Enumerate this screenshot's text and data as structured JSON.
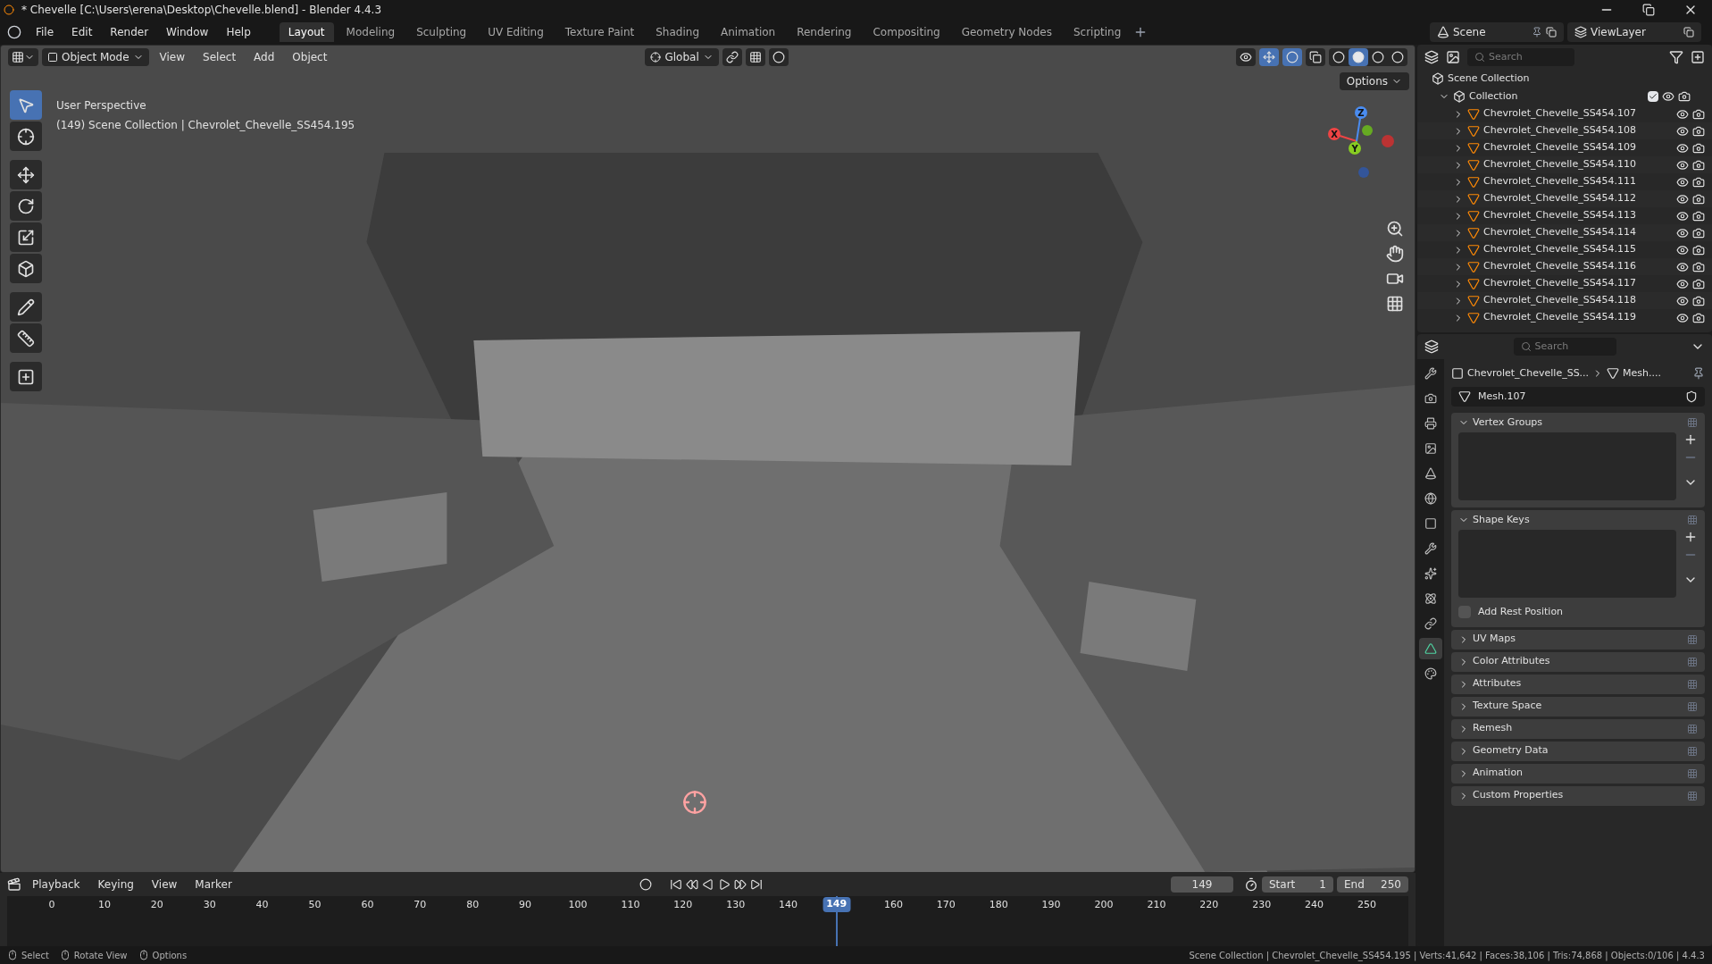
{
  "title_bar": {
    "title": "* Chevelle [C:\\Users\\erena\\Desktop\\Chevelle.blend] - Blender 4.4.3"
  },
  "menu": [
    "File",
    "Edit",
    "Render",
    "Window",
    "Help"
  ],
  "workspaces": [
    {
      "label": "Layout",
      "selected": true
    },
    {
      "label": "Modeling",
      "selected": false
    },
    {
      "label": "Sculpting",
      "selected": false
    },
    {
      "label": "UV Editing",
      "selected": false
    },
    {
      "label": "Texture Paint",
      "selected": false
    },
    {
      "label": "Shading",
      "selected": false
    },
    {
      "label": "Animation",
      "selected": false
    },
    {
      "label": "Rendering",
      "selected": false
    },
    {
      "label": "Compositing",
      "selected": false
    },
    {
      "label": "Geometry Nodes",
      "selected": false
    },
    {
      "label": "Scripting",
      "selected": false
    }
  ],
  "scene": {
    "name": "Scene",
    "view_layer": "ViewLayer"
  },
  "viewport_header": {
    "mode": "Object Mode",
    "menus": [
      "View",
      "Select",
      "Add",
      "Object"
    ],
    "orientation": "Global",
    "options": "Options",
    "shading_modes": [
      {
        "kind": "wireframe",
        "selected": false
      },
      {
        "kind": "solid",
        "selected": true
      },
      {
        "kind": "material",
        "selected": false
      },
      {
        "kind": "rendered",
        "selected": false
      }
    ]
  },
  "tools": [
    {
      "kind": "select",
      "selected": true
    },
    {
      "kind": "cursor",
      "selected": false
    },
    {
      "kind": "move",
      "selected": false
    },
    {
      "kind": "rotate",
      "selected": false
    },
    {
      "kind": "scale",
      "selected": false
    },
    {
      "kind": "transform",
      "selected": false
    },
    {
      "kind": "annotate",
      "selected": false
    },
    {
      "kind": "measure",
      "selected": false
    },
    {
      "kind": "add_cube",
      "selected": false
    }
  ],
  "viewport_info": [
    "User Perspective",
    "(149) Scene Collection | Chevrolet_Chevelle_SS454.195"
  ],
  "gizmo_axes": [
    "Z",
    "X",
    "Y"
  ],
  "outliner": {
    "search_placeholder": "Search",
    "root": "Scene Collection",
    "collection": {
      "name": "Collection",
      "expanded": true,
      "checked": true,
      "children": [
        {
          "name": "Chevrolet_Chevelle_SS454.107",
          "expanded": false
        },
        {
          "name": "Chevrolet_Chevelle_SS454.108",
          "expanded": false
        },
        {
          "name": "Chevrolet_Chevelle_SS454.109",
          "expanded": false
        },
        {
          "name": "Chevrolet_Chevelle_SS454.110",
          "expanded": false
        },
        {
          "name": "Chevrolet_Chevelle_SS454.111",
          "expanded": false
        },
        {
          "name": "Chevrolet_Chevelle_SS454.112",
          "expanded": false
        },
        {
          "name": "Chevrolet_Chevelle_SS454.113",
          "expanded": false
        },
        {
          "name": "Chevrolet_Chevelle_SS454.114",
          "expanded": false
        },
        {
          "name": "Chevrolet_Chevelle_SS454.115",
          "expanded": false
        },
        {
          "name": "Chevrolet_Chevelle_SS454.116",
          "expanded": false
        },
        {
          "name": "Chevrolet_Chevelle_SS454.117",
          "expanded": false
        },
        {
          "name": "Chevrolet_Chevelle_SS454.118",
          "expanded": false
        },
        {
          "name": "Chevrolet_Chevelle_SS454.119",
          "expanded": false
        }
      ]
    }
  },
  "properties": {
    "search_placeholder": "Search",
    "tabs": [
      {
        "kind": "tool",
        "selected": false
      },
      {
        "kind": "render",
        "selected": false
      },
      {
        "kind": "output",
        "selected": false
      },
      {
        "kind": "view_layer",
        "selected": false
      },
      {
        "kind": "scene",
        "selected": false
      },
      {
        "kind": "world",
        "selected": false
      },
      {
        "kind": "object",
        "selected": false
      },
      {
        "kind": "modifiers",
        "selected": false
      },
      {
        "kind": "particles",
        "selected": false
      },
      {
        "kind": "physics",
        "selected": false
      },
      {
        "kind": "constraints",
        "selected": false
      },
      {
        "kind": "data",
        "selected": true
      },
      {
        "kind": "material",
        "selected": false
      }
    ],
    "breadcrumb": [
      "Chevrolet_Chevelle_SS...",
      "Mesh...."
    ],
    "mesh_name": "Mesh.107",
    "panels": [
      {
        "title": "Vertex Groups",
        "expanded": true
      },
      {
        "title": "Shape Keys",
        "expanded": true,
        "checkbox": {
          "label": "Add Rest Position",
          "checked": false
        }
      },
      {
        "title": "UV Maps",
        "expanded": false
      },
      {
        "title": "Color Attributes",
        "expanded": false
      },
      {
        "title": "Attributes",
        "expanded": false
      },
      {
        "title": "Texture Space",
        "expanded": false
      },
      {
        "title": "Remesh",
        "expanded": false
      },
      {
        "title": "Geometry Data",
        "expanded": false
      },
      {
        "title": "Animation",
        "expanded": false
      },
      {
        "title": "Custom Properties",
        "expanded": false
      }
    ]
  },
  "timeline": {
    "menus": [
      "Playback",
      "Keying",
      "View",
      "Marker"
    ],
    "current_frame": "149",
    "start_label": "Start",
    "start": "1",
    "end_label": "End",
    "end": "250",
    "ticks_before": [
      "0",
      "10",
      "20",
      "30",
      "40",
      "50",
      "60",
      "70",
      "80",
      "90",
      "100",
      "110",
      "120",
      "130",
      "140"
    ],
    "ticks_after": [
      "160",
      "170",
      "180",
      "190",
      "200",
      "210",
      "220",
      "230",
      "240",
      "250"
    ],
    "playhead": {
      "label": "149",
      "level": 0.596
    }
  },
  "status_bar": {
    "hints": [
      "Select",
      "Rotate View",
      "Options"
    ],
    "stats": "Scene Collection | Chevrolet_Chevelle_SS454.195 | Verts:41,642 | Faces:38,106 | Tris:74,868 | Objects:0/106 | 4.4.3"
  }
}
